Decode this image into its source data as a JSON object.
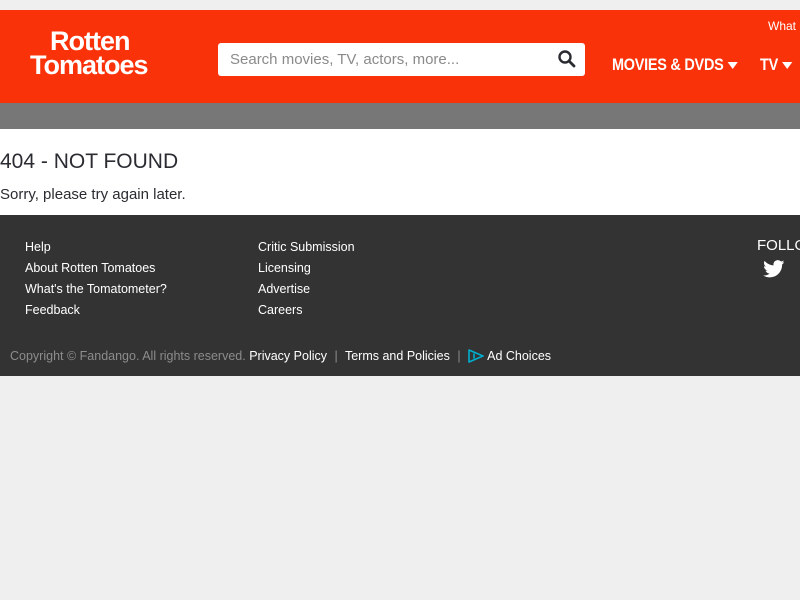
{
  "brand": {
    "logo_line1": "Rotten",
    "logo_line2": "Tomatoes"
  },
  "header": {
    "search_placeholder": "Search movies, TV, actors, more...",
    "nav": [
      {
        "label": "MOVIES & DVDS"
      },
      {
        "label": "TV"
      }
    ],
    "top_link": "What"
  },
  "main": {
    "title": "404 - NOT FOUND",
    "message": "Sorry, please try again later."
  },
  "footer": {
    "col1": [
      "Help",
      "About Rotten Tomatoes",
      "What's the Tomatometer?",
      "Feedback"
    ],
    "col2": [
      "Critic Submission",
      "Licensing",
      "Advertise",
      "Careers"
    ],
    "follow": "FOLLO",
    "copyright": "Copyright © Fandango. All rights reserved.",
    "privacy": "Privacy Policy",
    "terms": "Terms and Policies",
    "adchoices": "Ad Choices",
    "separator": "|"
  },
  "colors": {
    "brand_red": "#fa320a",
    "footer_bg": "#333333",
    "subbar": "#777777",
    "adchoices_accent": "#00aecd"
  },
  "icons": [
    "search-icon",
    "chevron-down-icon",
    "twitter-icon",
    "adchoices-icon"
  ]
}
